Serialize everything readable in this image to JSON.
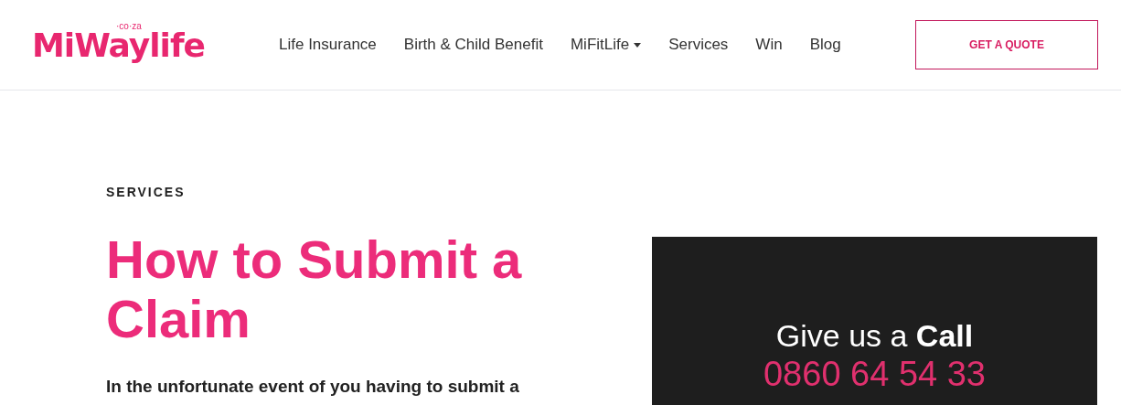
{
  "header": {
    "logo": {
      "name": "MiWaylife",
      "suffix": "·co·za"
    },
    "nav": [
      {
        "label": "Life Insurance",
        "dropdown": false
      },
      {
        "label": "Birth & Child Benefit",
        "dropdown": false
      },
      {
        "label": "MiFitLife",
        "dropdown": true
      },
      {
        "label": "Services",
        "dropdown": false
      },
      {
        "label": "Win",
        "dropdown": false
      },
      {
        "label": "Blog",
        "dropdown": false
      }
    ],
    "cta": "GET A QUOTE"
  },
  "main": {
    "eyebrow": "SERVICES",
    "title": "How to Submit a Claim",
    "intro": "In the unfortunate event of you having to submit a"
  },
  "call_box": {
    "heading": "Give us a **Call**",
    "phone": "0860 64 54 33"
  }
}
